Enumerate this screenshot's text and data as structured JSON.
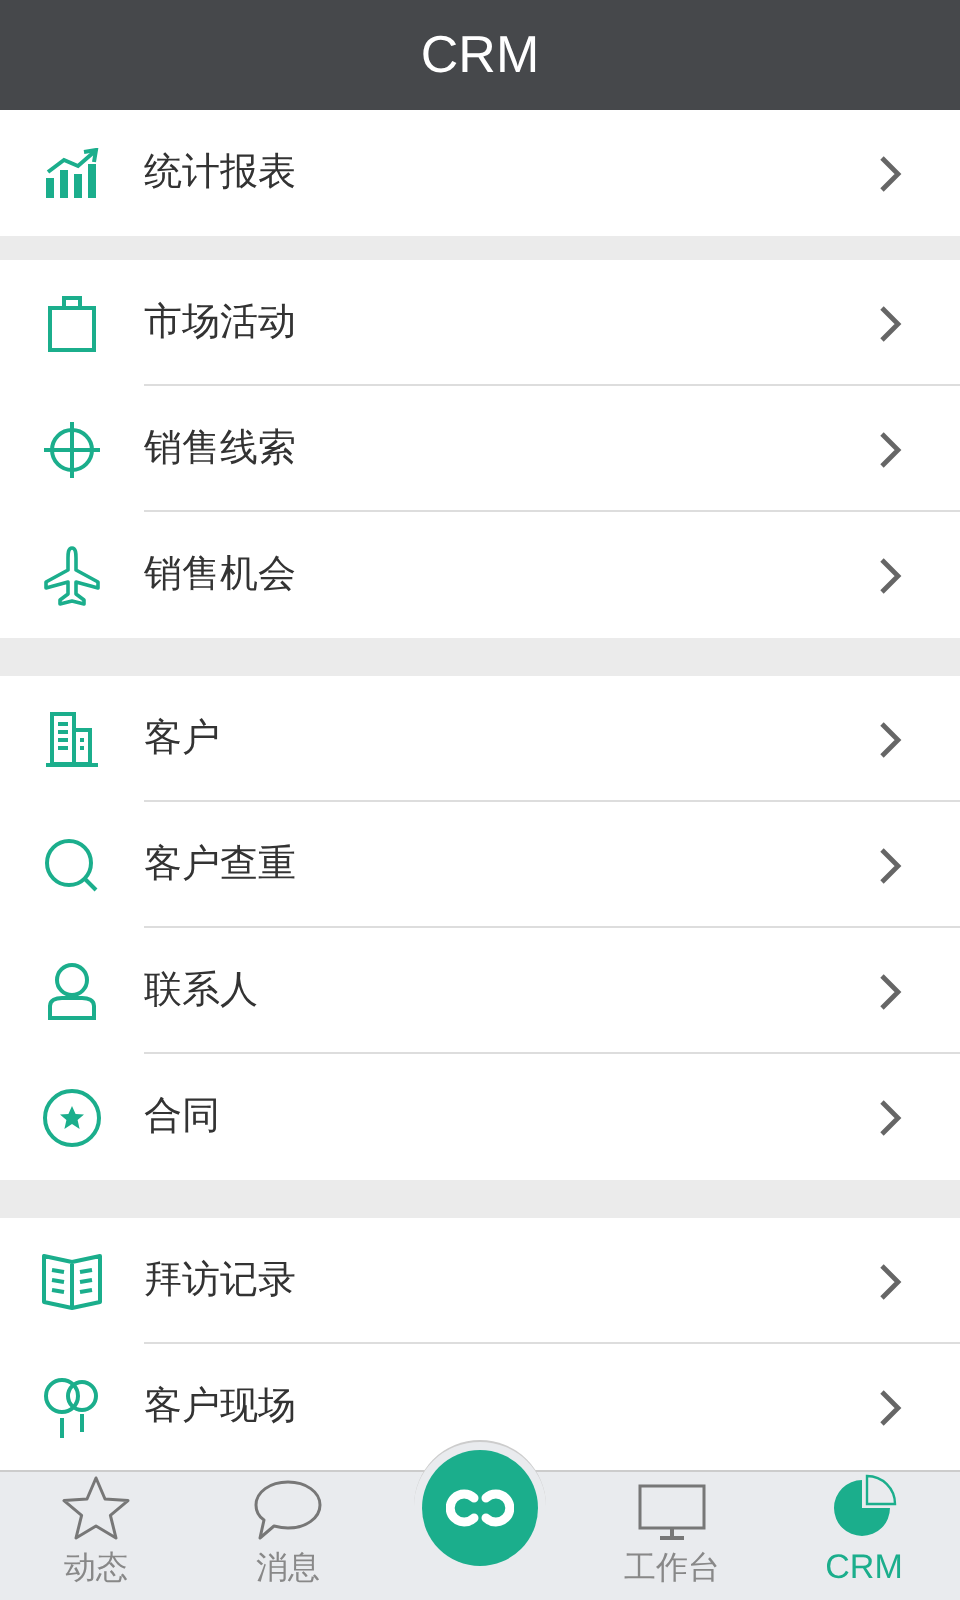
{
  "header": {
    "title": "CRM"
  },
  "groups": [
    {
      "items": [
        {
          "kind": "chart",
          "label": "统计报表"
        }
      ]
    },
    {
      "items": [
        {
          "kind": "bag",
          "label": "市场活动"
        },
        {
          "kind": "target",
          "label": "销售线索"
        },
        {
          "kind": "plane",
          "label": "销售机会"
        }
      ]
    },
    {
      "items": [
        {
          "kind": "building",
          "label": "客户"
        },
        {
          "kind": "search",
          "label": "客户查重"
        },
        {
          "kind": "person",
          "label": "联系人"
        },
        {
          "kind": "star-circle",
          "label": "合同"
        }
      ]
    },
    {
      "items": [
        {
          "kind": "book",
          "label": "拜访记录"
        },
        {
          "kind": "pins",
          "label": "客户现场"
        }
      ]
    }
  ],
  "tabs": [
    {
      "kind": "star",
      "label": "动态",
      "selected": false
    },
    {
      "kind": "bubble",
      "label": "消息",
      "selected": false
    },
    {
      "kind": "center"
    },
    {
      "kind": "monitor",
      "label": "工作台",
      "selected": false
    },
    {
      "kind": "pie",
      "label": "CRM",
      "selected": true
    }
  ]
}
